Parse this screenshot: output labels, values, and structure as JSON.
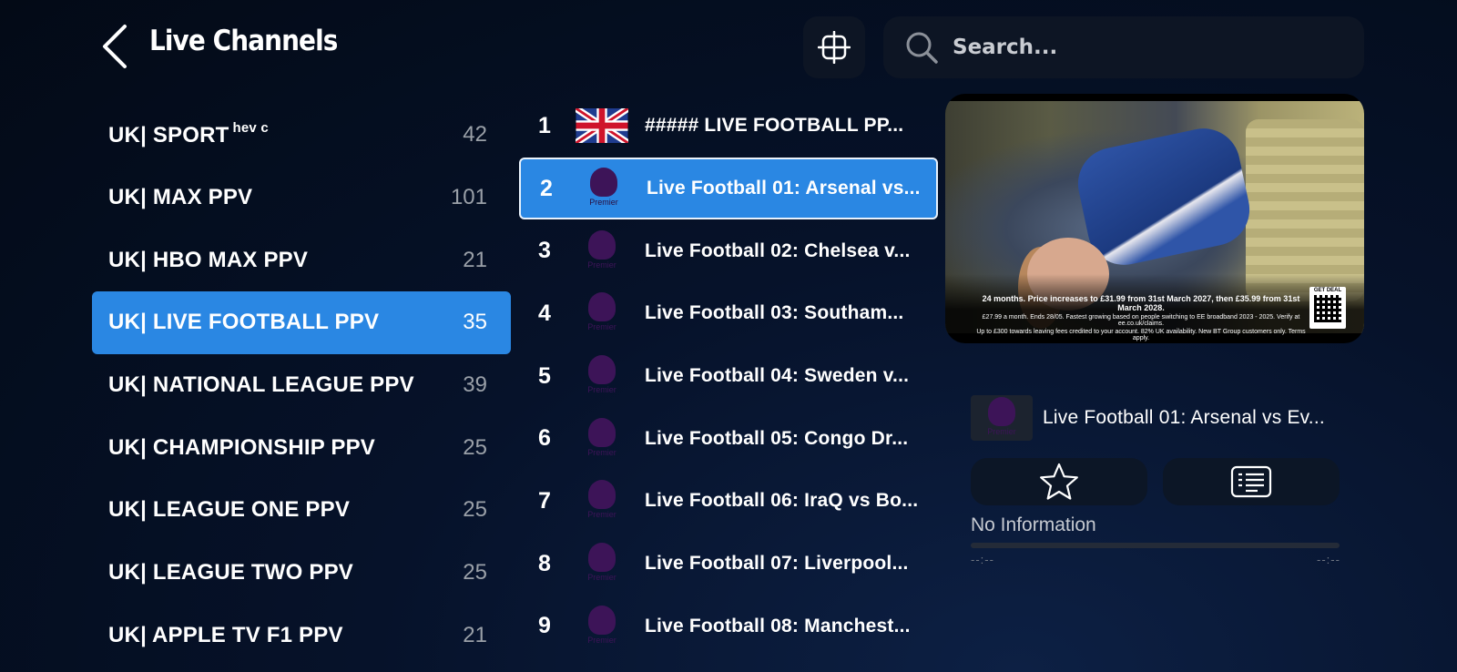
{
  "header": {
    "title": "Live Channels",
    "search_placeholder": "Search..."
  },
  "categories": [
    {
      "name": "UK| SPORT",
      "tag": "hev c",
      "count": "42",
      "selected": false
    },
    {
      "name": "UK| MAX PPV",
      "tag": "",
      "count": "101",
      "selected": false
    },
    {
      "name": "UK| HBO MAX PPV",
      "tag": "",
      "count": "21",
      "selected": false
    },
    {
      "name": "UK| LIVE FOOTBALL PPV",
      "tag": "",
      "count": "35",
      "selected": true
    },
    {
      "name": "UK| NATIONAL LEAGUE PPV",
      "tag": "",
      "count": "39",
      "selected": false
    },
    {
      "name": "UK| CHAMPIONSHIP PPV",
      "tag": "",
      "count": "25",
      "selected": false
    },
    {
      "name": "UK| LEAGUE ONE PPV",
      "tag": "",
      "count": "25",
      "selected": false
    },
    {
      "name": "UK| LEAGUE TWO PPV",
      "tag": "",
      "count": "25",
      "selected": false
    },
    {
      "name": "UK| APPLE TV F1 PPV",
      "tag": "",
      "count": "21",
      "selected": false
    }
  ],
  "channels": [
    {
      "number": "1",
      "name": "##### LIVE FOOTBALL PP...",
      "logo": "uk-flag-icon",
      "selected": false
    },
    {
      "number": "2",
      "name": "Live Football 01: Arsenal vs...",
      "logo": "premier-league-logo",
      "selected": true
    },
    {
      "number": "3",
      "name": "Live Football 02: Chelsea v...",
      "logo": "premier-league-logo",
      "selected": false
    },
    {
      "number": "4",
      "name": "Live Football 03: Southam...",
      "logo": "premier-league-logo",
      "selected": false
    },
    {
      "number": "5",
      "name": "Live Football 04: Sweden v...",
      "logo": "premier-league-logo",
      "selected": false
    },
    {
      "number": "6",
      "name": "Live Football 05: Congo Dr...",
      "logo": "premier-league-logo",
      "selected": false
    },
    {
      "number": "7",
      "name": "Live Football 06: IraQ vs Bo...",
      "logo": "premier-league-logo",
      "selected": false
    },
    {
      "number": "8",
      "name": "Live Football 07: Liverpool...",
      "logo": "premier-league-logo",
      "selected": false
    },
    {
      "number": "9",
      "name": "Live Football 08: Manchest...",
      "logo": "premier-league-logo",
      "selected": false
    }
  ],
  "logo_text": "Premier",
  "preview": {
    "ad_line1": "24 months. Price increases to £31.99 from 31st March 2027, then £35.99 from 31st March 2028.",
    "ad_line2": "£27.99 a month. Ends 28/05. Fastest growing based on people switching to EE broadband 2023 - 2025. Verify at ee.co.uk/claims.",
    "ad_line3": "Up to £300 towards leaving fees credited to your account. 82% UK availability. New BT Group customers only. Terms apply.",
    "qr_label": "GET DEAL"
  },
  "now_playing": {
    "title": "Live Football 01: Arsenal vs Ev...",
    "info": "No Information",
    "time_start": "--:--",
    "time_end": "--:--",
    "progress": 0
  },
  "colors": {
    "accent": "#2a87e3",
    "background": "#030a16",
    "panel": "#0d1524"
  }
}
